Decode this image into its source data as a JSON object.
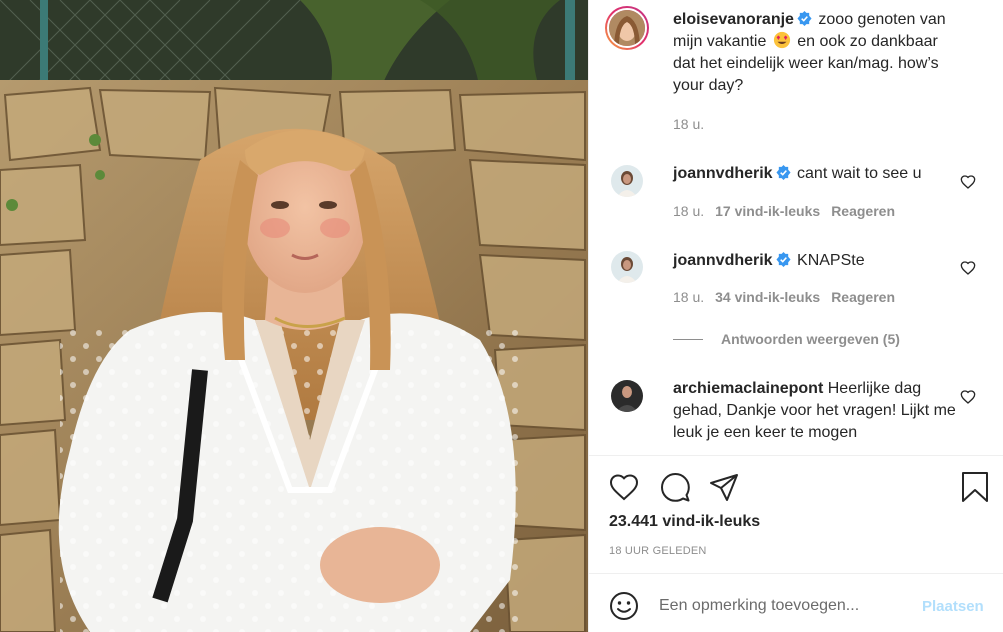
{
  "post": {
    "author": "eloisevanoranje",
    "caption_part1": "zooo genoten van mijn vakantie",
    "caption_part2": "en ook zo dankbaar dat het eindelijk weer kan/mag. how’s your day?",
    "caption_emoji": "smiling-face-with-heart-eyes",
    "caption_time": "18 u."
  },
  "comments": [
    {
      "username": "joannvdherik",
      "verified": true,
      "text": "cant wait to see u",
      "time": "18 u.",
      "likes": "17 vind-ik-leuks",
      "reply": "Reageren"
    },
    {
      "username": "joannvdherik",
      "verified": true,
      "text": "KNAPSte",
      "time": "18 u.",
      "likes": "34 vind-ik-leuks",
      "reply": "Reageren",
      "view_replies": "Antwoorden weergeven (5)"
    },
    {
      "username": "archiemaclainepont",
      "verified": false,
      "text": "Heerlijke dag gehad, Dankje voor het vragen! Lijkt me leuk je een keer te mogen"
    }
  ],
  "actions": {
    "like_icon": "heart-icon",
    "comment_icon": "comment-icon",
    "share_icon": "paper-plane-icon",
    "save_icon": "bookmark-icon"
  },
  "likes_count": "23.441 vind-ik-leuks",
  "post_time": "18 UUR GELEDEN",
  "add_comment": {
    "placeholder": "Een opmerking toevoegen...",
    "post_label": "Plaatsen"
  },
  "colors": {
    "verified_blue": "#3897f0",
    "text_primary": "#262626",
    "text_secondary": "#8e8e8e",
    "post_button_disabled": "#b2dffc"
  }
}
